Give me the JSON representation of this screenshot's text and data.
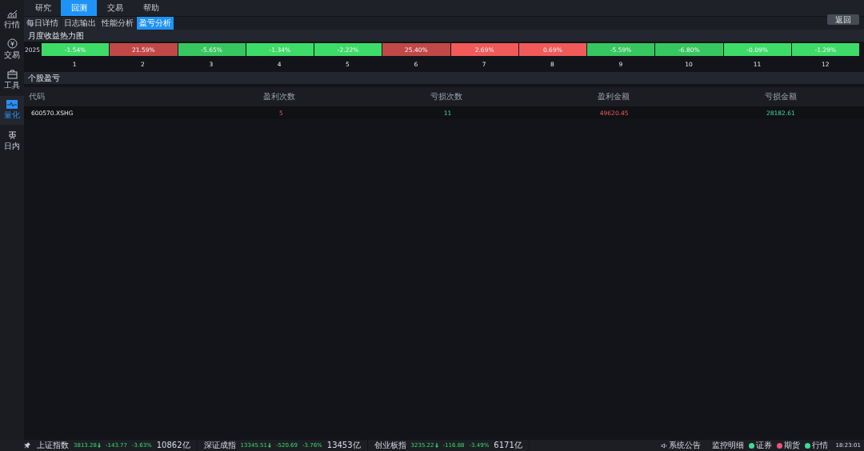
{
  "sidebar": {
    "items": [
      {
        "label": "行情",
        "selected": false
      },
      {
        "label": "交易",
        "selected": false
      },
      {
        "label": "工具",
        "selected": false
      },
      {
        "label": "量化",
        "selected": true
      },
      {
        "label": "日内",
        "selected": false
      }
    ]
  },
  "tabs": [
    {
      "label": "研究",
      "selected": false
    },
    {
      "label": "回测",
      "selected": true
    },
    {
      "label": "交易",
      "selected": false
    },
    {
      "label": "帮助",
      "selected": false
    }
  ],
  "subtabs": [
    {
      "label": "每日详情",
      "selected": false
    },
    {
      "label": "日志输出",
      "selected": false
    },
    {
      "label": "性能分析",
      "selected": false
    },
    {
      "label": "盈亏分析",
      "selected": true
    }
  ],
  "back_button": "返回",
  "heatmap": {
    "title": "月度收益热力图",
    "year": "2025",
    "cells": [
      {
        "value": "-1.54%",
        "color": "#3ddc68"
      },
      {
        "value": "21.59%",
        "color": "#c24848"
      },
      {
        "value": "-5.65%",
        "color": "#37c760"
      },
      {
        "value": "-1.34%",
        "color": "#3ddc68"
      },
      {
        "value": "-2.22%",
        "color": "#3ddc68"
      },
      {
        "value": "25.40%",
        "color": "#c24848"
      },
      {
        "value": "2.69%",
        "color": "#f25a5a"
      },
      {
        "value": "0.69%",
        "color": "#f25a5a"
      },
      {
        "value": "-5.59%",
        "color": "#37c760"
      },
      {
        "value": "-6.80%",
        "color": "#37c760"
      },
      {
        "value": "-0.09%",
        "color": "#3ddc68"
      },
      {
        "value": "-1.29%",
        "color": "#3ddc68"
      }
    ],
    "months": [
      "1",
      "2",
      "3",
      "4",
      "5",
      "6",
      "7",
      "8",
      "9",
      "10",
      "11",
      "12"
    ]
  },
  "pnl": {
    "title": "个股盈亏",
    "columns": [
      "代码",
      "盈利次数",
      "亏损次数",
      "盈利金额",
      "亏损金额"
    ],
    "rows": [
      [
        "600570.XSHG",
        "5",
        "11",
        "49620.45",
        "28182.61"
      ]
    ]
  },
  "status_bar": {
    "indices": [
      {
        "name": "上证指数",
        "price": "3813.28",
        "change": "-143.77",
        "pct": "-3.63%",
        "volume": "10862亿"
      },
      {
        "name": "深证成指",
        "price": "13345.51",
        "change": "-520.69",
        "pct": "-3.76%",
        "volume": "13453亿"
      },
      {
        "name": "创业板指",
        "price": "3235.22",
        "change": "-116.88",
        "pct": "-3.49%",
        "volume": "6171亿"
      }
    ],
    "notice": "系统公告",
    "monitor": "监控明细",
    "connections": [
      {
        "label": "证券",
        "color": "#3ddc98"
      },
      {
        "label": "期货",
        "color": "#f0507a"
      },
      {
        "label": "行情",
        "color": "#3ddc98"
      }
    ],
    "time": "18:23:01"
  }
}
